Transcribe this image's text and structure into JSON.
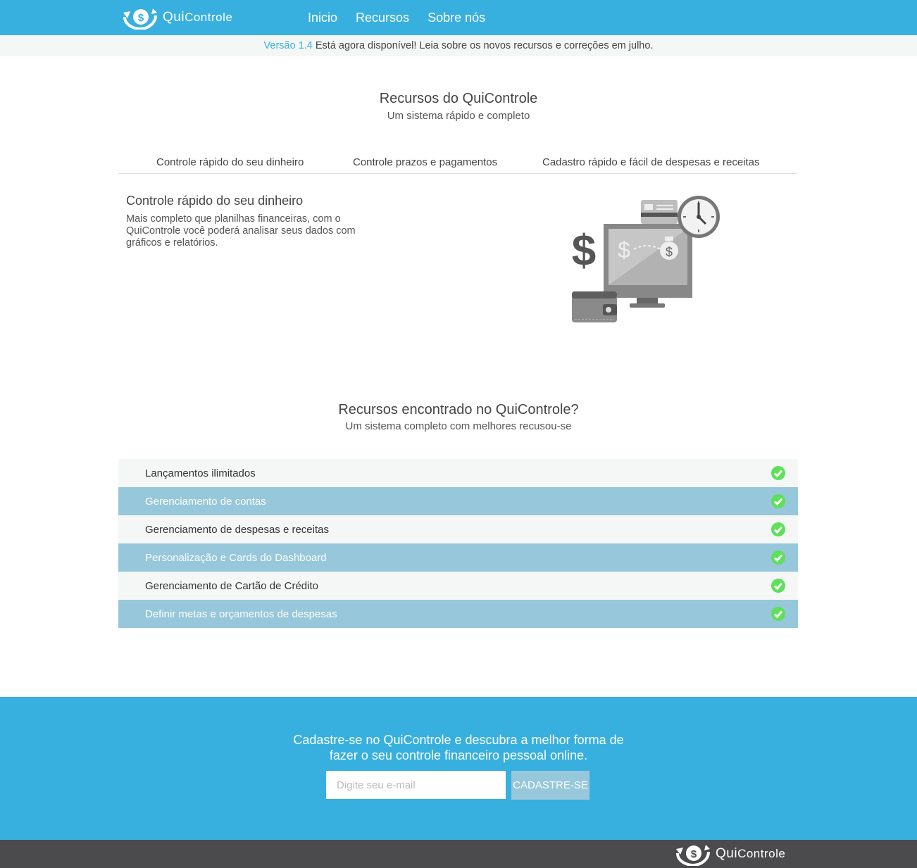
{
  "brand": {
    "name_first": "Qui",
    "name_rest": "Controle"
  },
  "nav": {
    "items": [
      "Inicio",
      "Recursos",
      "Sobre nós"
    ]
  },
  "announcement": {
    "version": "Versão 1.4",
    "text": " Está agora disponível! Leia sobre os novos recursos e correções em julho."
  },
  "resources": {
    "title": "Recursos do QuiControle",
    "subtitle": "Um sistema rápido e completo",
    "tabs": [
      "Controle rápido do seu dinheiro",
      "Controle prazos e pagamentos",
      "Cadastro rápido e fácil de despesas e receitas"
    ],
    "active_heading": "Controle rápido do seu dinheiro",
    "active_description": "Mais completo que planilhas financeiras, com o QuiControle você poderá analisar seus dados com gráficos e relatórios."
  },
  "features": {
    "title": "Recursos encontrado no QuiControle?",
    "subtitle": "Um sistema completo com melhores recusou-se",
    "items": [
      "Lançamentos ilimitados",
      "Gerenciamento de contas",
      "Gerenciamento de despesas e receitas",
      "Personalização e Cards do Dashboard",
      "Gerenciamento de Cartão de Crédito",
      "Definir metas e orçamentos de despesas"
    ]
  },
  "cta": {
    "line1": "Cadastre-se no QuiControle e descubra a melhor forma de",
    "line2": "fazer o seu controle financeiro pessoal online.",
    "email_placeholder": "Digite seu e-mail",
    "button": "CADASTRE-SE"
  },
  "colors": {
    "primary": "#37b0df",
    "row_blue": "#96c7da",
    "row_light": "#f4f7f6",
    "check": "#5ee05a",
    "footer": "#4b4b4d"
  }
}
